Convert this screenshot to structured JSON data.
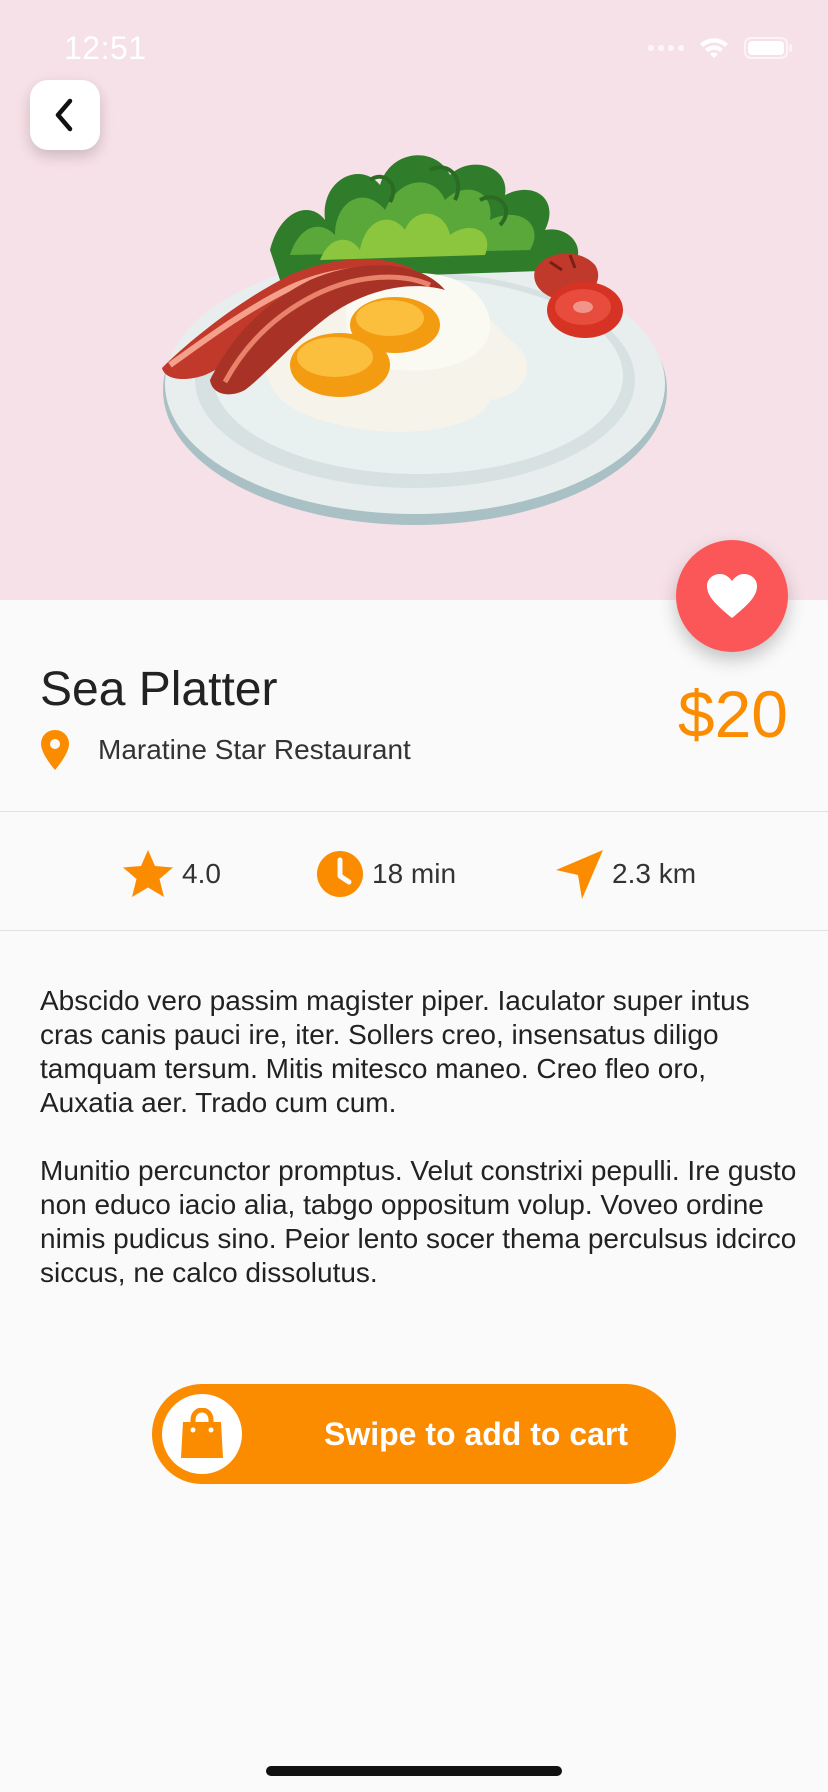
{
  "status_bar": {
    "time": "12:51"
  },
  "dish": {
    "name": "Sea Platter",
    "restaurant": "Maratine Star Restaurant",
    "price": "$20"
  },
  "stats": {
    "rating": "4.0",
    "time": "18 min",
    "distance": "2.3 km"
  },
  "description": {
    "paragraphs": [
      "Abscido vero passim magister piper. Iaculator super intus cras canis pauci ire, iter. Sollers creo, insensatus diligo tamquam tersum. Mitis mitesco maneo. Creo fleo oro, Auxatia aer. Trado cum cum.",
      "Munitio percunctor promptus. Velut constrixi pepulli. Ire gusto non educo iacio alia, tabgo oppositum volup. Voveo ordine nimis pudicus sino. Peior lento socer thema perculsus idcirco siccus, ne calco dissolutus."
    ]
  },
  "cart": {
    "label": "Swipe to add to cart"
  },
  "colors": {
    "accent": "#fb8c00",
    "favorite": "#fb5758",
    "hero_background": "#f7e1e8"
  },
  "icons": [
    "chevron-left-icon",
    "heart-icon",
    "location-pin-icon",
    "star-icon",
    "clock-icon",
    "navigation-icon",
    "shopping-bag-icon",
    "wifi-icon",
    "battery-icon"
  ]
}
